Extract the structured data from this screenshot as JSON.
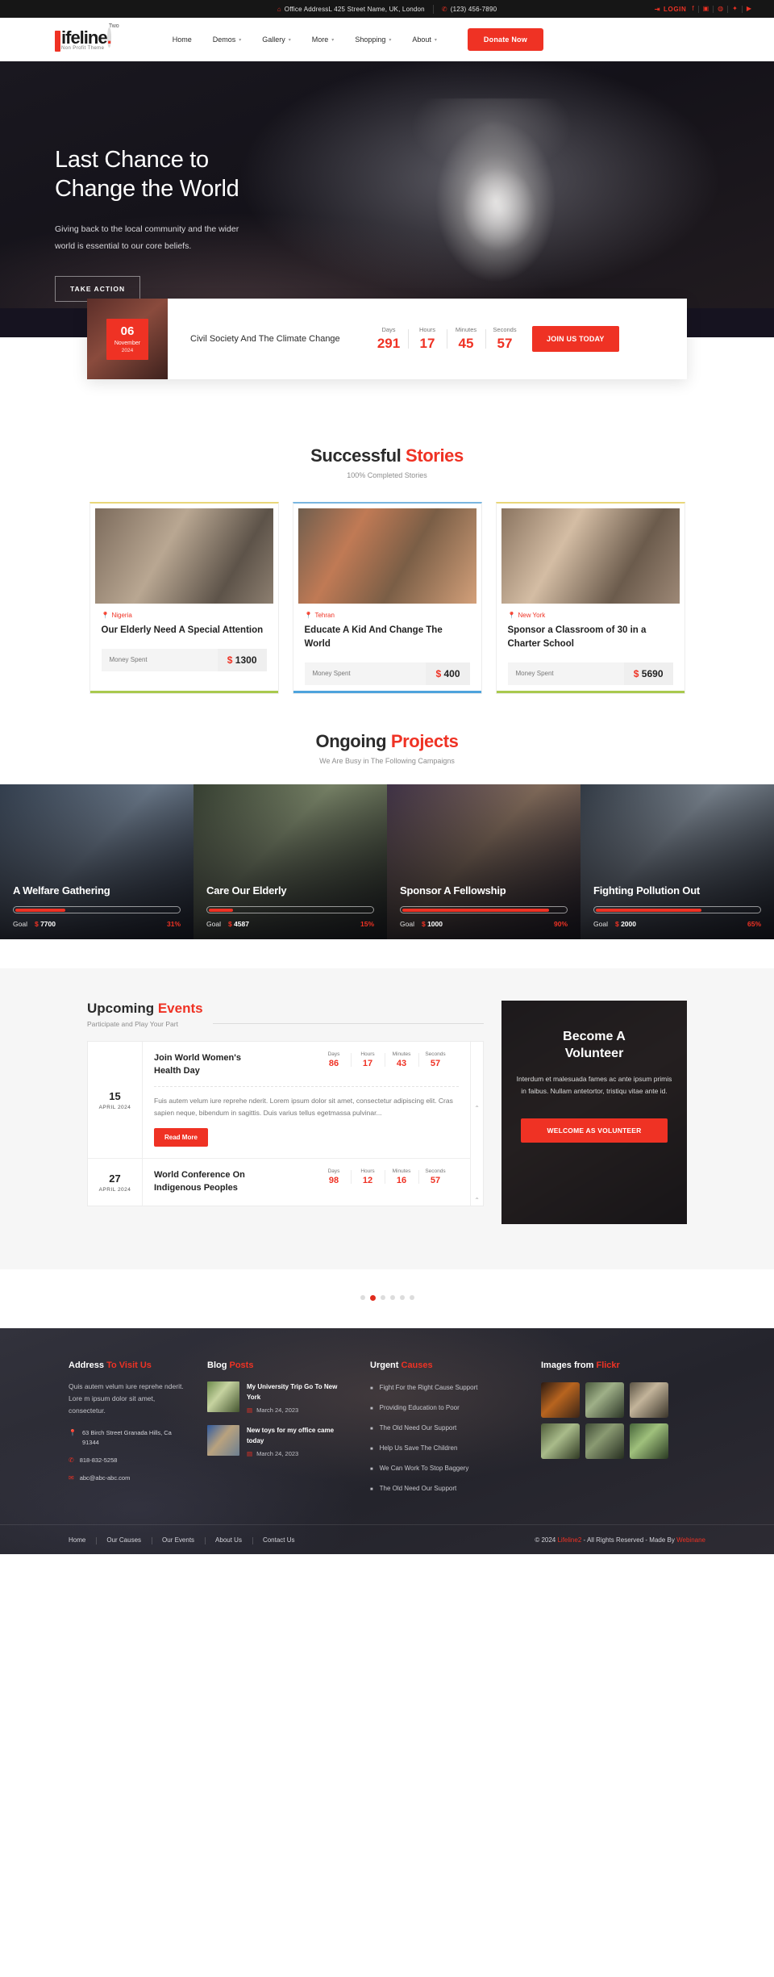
{
  "topbar": {
    "address_icon": "home-icon",
    "address": "Office AddressL 425 Street Name, UK, London",
    "phone_icon": "phone-icon",
    "phone": "(123) 456-7890",
    "login_label": "LOGIN",
    "login_icon": "login-icon",
    "social": [
      {
        "name": "facebook-icon",
        "glyph": "f"
      },
      {
        "name": "instagram-icon",
        "glyph": "▣"
      },
      {
        "name": "snapchat-icon",
        "glyph": "◍"
      },
      {
        "name": "twitter-icon",
        "glyph": "✦"
      },
      {
        "name": "youtube-icon",
        "glyph": "▶"
      }
    ]
  },
  "header": {
    "logo_main": "ifeline",
    "logo_dot": ".",
    "logo_badge": "Two",
    "logo_sub": "Non Profit Theme",
    "nav": [
      {
        "label": "Home",
        "has_caret": false
      },
      {
        "label": "Demos",
        "has_caret": true
      },
      {
        "label": "Gallery",
        "has_caret": true
      },
      {
        "label": "More",
        "has_caret": true
      },
      {
        "label": "Shopping",
        "has_caret": true
      },
      {
        "label": "About",
        "has_caret": true
      }
    ],
    "donate_label": "Donate Now"
  },
  "hero": {
    "title_line1": "Last Chance to",
    "title_line2": "Change the World",
    "subtitle": "Giving back to the local community and the wider world is essential to our core beliefs.",
    "button_label": "TAKE ACTION"
  },
  "countdown_bar": {
    "day": "06",
    "month": "November",
    "year": "2024",
    "title": "Civil Society And The Climate Change",
    "units": [
      {
        "label": "Days",
        "value": "291"
      },
      {
        "label": "Hours",
        "value": "17"
      },
      {
        "label": "Minutes",
        "value": "45"
      },
      {
        "label": "Seconds",
        "value": "57"
      }
    ],
    "button_label": "JOIN US TODAY"
  },
  "stories": {
    "title_black": "Successful ",
    "title_accent": "Stories",
    "subtitle": "100% Completed Stories",
    "money_label": "Money Spent",
    "cards": [
      {
        "location": "Nigeria",
        "title": "Our Elderly Need A Special Attention",
        "money_label": "Money Spent",
        "currency": "$",
        "amount": "1300"
      },
      {
        "location": "Tehran",
        "title": "Educate A Kid And Change The World",
        "money_label": "Money Spent",
        "currency": "$",
        "amount": "400"
      },
      {
        "location": "New York",
        "title": "Sponsor a Classroom of 30 in a Charter School",
        "money_label": "Money Spent",
        "currency": "$",
        "amount": "5690"
      }
    ]
  },
  "projects": {
    "title_black": "Ongoing ",
    "title_accent": "Projects",
    "subtitle": "We Are Busy in The Following Campaigns",
    "goal_label": "Goal",
    "cards": [
      {
        "title": "A Welfare Gathering",
        "goal_label": "Goal",
        "currency": "$",
        "goal": "7700",
        "percent": "31%",
        "percent_value": 31
      },
      {
        "title": "Care Our Elderly",
        "goal_label": "Goal",
        "currency": "$",
        "goal": "4587",
        "percent": "15%",
        "percent_value": 15
      },
      {
        "title": "Sponsor A Fellowship",
        "goal_label": "Goal",
        "currency": "$",
        "goal": "1000",
        "percent": "90%",
        "percent_value": 90
      },
      {
        "title": "Fighting Pollution Out",
        "goal_label": "Goal",
        "currency": "$",
        "goal": "2000",
        "percent": "65%",
        "percent_value": 65
      }
    ]
  },
  "events": {
    "title_black": "Upcoming ",
    "title_accent": "Events",
    "subtitle": "Participate and Play Your Part",
    "items": [
      {
        "day": "15",
        "month_year": "APRIL 2024",
        "name": "Join World Women's Health Day",
        "units": [
          {
            "label": "Days",
            "value": "86"
          },
          {
            "label": "Hours",
            "value": "17"
          },
          {
            "label": "Minutes",
            "value": "43"
          },
          {
            "label": "Seconds",
            "value": "57"
          }
        ],
        "description": "Fuis autem velum iure reprehe nderit. Lorem ipsum dolor sit amet, consectetur adipiscing elit. Cras sapien neque, bibendum in sagittis. Duis varius tellus egetmassa pulvinar...",
        "read_more": "Read More"
      },
      {
        "day": "27",
        "month_year": "APRIL 2024",
        "name": "World Conference On Indigenous Peoples",
        "units": [
          {
            "label": "Days",
            "value": "98"
          },
          {
            "label": "Hours",
            "value": "12"
          },
          {
            "label": "Minutes",
            "value": "16"
          },
          {
            "label": "Seconds",
            "value": "57"
          }
        ],
        "description": "",
        "read_more": ""
      }
    ]
  },
  "volunteer": {
    "title_line1": "Become A",
    "title_line2": "Volunteer",
    "paragraph": "Interdum et malesuada fames ac ante ipsum primis in faibus. Nullam antetortor, tristiqu vitae ante id.",
    "button_label": "WELCOME AS VOLUNTEER"
  },
  "carousel": {
    "dot_count": 6,
    "active_index": 1
  },
  "footer": {
    "address": {
      "title_white": "Address ",
      "title_accent": "To Visit Us",
      "paragraph": "Quis autem velum iure reprehe nderit. Lore m ipsum dolor sit amet, consectetur.",
      "contacts": [
        {
          "icon": "map-pin-icon",
          "text": "63 Birch Street Granada Hills, Ca 91344"
        },
        {
          "icon": "phone-icon",
          "text": "818-832-5258"
        },
        {
          "icon": "mail-icon",
          "text": "abc@abc-abc.com"
        }
      ]
    },
    "blog": {
      "title_white": "Blog ",
      "title_accent": "Posts",
      "posts": [
        {
          "title": "My University Trip Go To New York",
          "date": "March 24, 2023"
        },
        {
          "title": "New toys for my office came today",
          "date": "March 24, 2023"
        }
      ]
    },
    "causes": {
      "title_white": "Urgent ",
      "title_accent": "Causes",
      "items": [
        "Fight For the Right Cause Support",
        "Providing Education to Poor",
        "The Old Need Our Support",
        "Help Us Save The Children",
        "We Can Work To Stop Baggery",
        "The Old Need Our Support"
      ]
    },
    "flickr": {
      "title_white": "Images from ",
      "title_accent": "Flickr",
      "image_count": 6
    },
    "bottom": {
      "links": [
        "Home",
        "Our Causes",
        "Our Events",
        "About Us",
        "Contact Us"
      ],
      "copy_pre": "© 2024 ",
      "copy_brand": "Lifeline2",
      "copy_mid": " - All Rights Reserved - Made By ",
      "copy_author": "Webinane"
    }
  },
  "colors": {
    "accent": "#ef3224",
    "dark": "#161616",
    "footer_bg": "#2b2b33"
  }
}
